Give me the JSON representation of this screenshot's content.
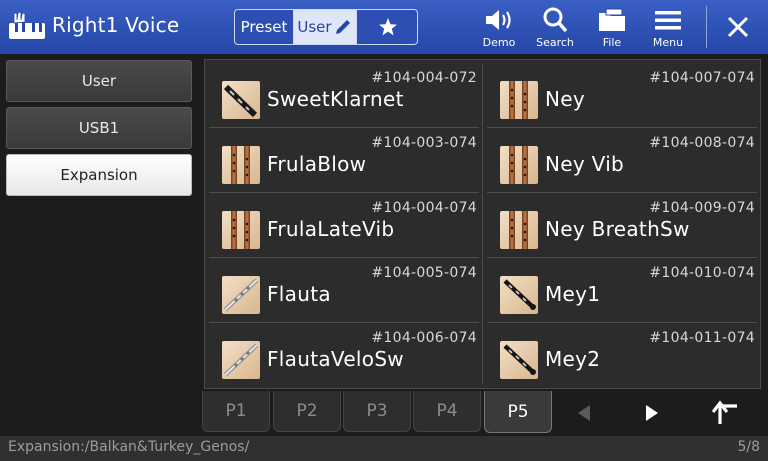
{
  "header": {
    "title": "Right1 Voice",
    "seg_preset": "Preset",
    "seg_user": "User",
    "tools": {
      "demo": "Demo",
      "search": "Search",
      "file": "File",
      "menu": "Menu"
    }
  },
  "sidebar": {
    "tabs": [
      {
        "label": "User"
      },
      {
        "label": "USB1"
      },
      {
        "label": "Expansion"
      }
    ],
    "selected": "Expansion"
  },
  "voices": [
    {
      "name": "SweetKlarnet",
      "number": "#104-004-072",
      "icon": "clarinet-icon"
    },
    {
      "name": "Ney",
      "number": "#104-007-074",
      "icon": "wooden-flute-icon"
    },
    {
      "name": "FrulaBlow",
      "number": "#104-003-074",
      "icon": "wooden-flute-icon"
    },
    {
      "name": "Ney Vib",
      "number": "#104-008-074",
      "icon": "wooden-flute-icon"
    },
    {
      "name": "FrulaLateVib",
      "number": "#104-004-074",
      "icon": "wooden-flute-icon"
    },
    {
      "name": "Ney BreathSw",
      "number": "#104-009-074",
      "icon": "wooden-flute-icon"
    },
    {
      "name": "Flauta",
      "number": "#104-005-074",
      "icon": "silver-flute-icon"
    },
    {
      "name": "Mey1",
      "number": "#104-010-074",
      "icon": "oboe-icon"
    },
    {
      "name": "FlautaVeloSw",
      "number": "#104-006-074",
      "icon": "silver-flute-icon"
    },
    {
      "name": "Mey2",
      "number": "#104-011-074",
      "icon": "oboe-icon"
    }
  ],
  "pages": {
    "labels": [
      "P1",
      "P2",
      "P3",
      "P4",
      "P5"
    ],
    "active": "P5"
  },
  "status": {
    "path": "Expansion:/Balkan&Turkey_Genos/",
    "page_count": "5/8"
  },
  "colors": {
    "header": "#2d4fb4",
    "background": "#1c1c1c",
    "grid": "#2c2c2c"
  }
}
